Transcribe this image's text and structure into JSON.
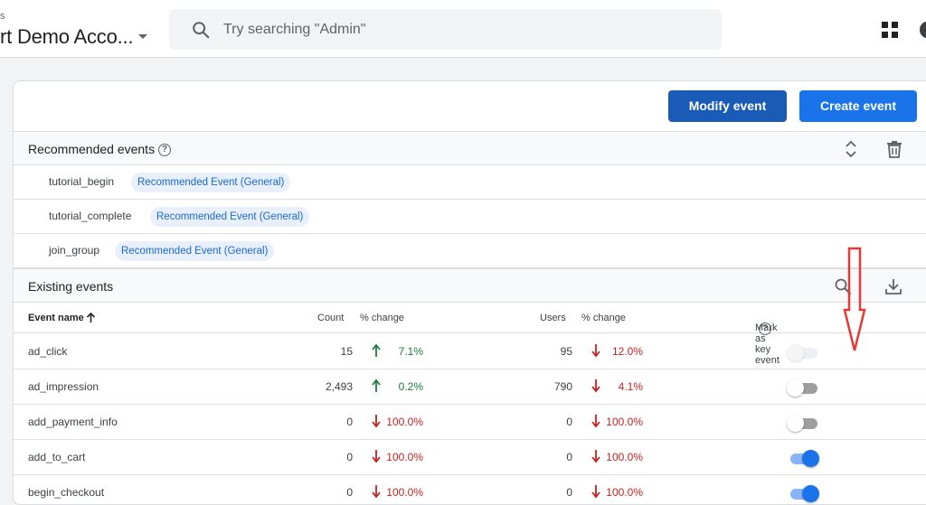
{
  "header": {
    "account_crumb": "s",
    "account_name": "rt Demo Acco...",
    "search_placeholder": "Try searching \"Admin\"",
    "apps_icon": "apps-grid-icon",
    "avatar_color": "#3c4043"
  },
  "actions": {
    "modify_label": "Modify event",
    "create_label": "Create event",
    "modify_color": "#1a5bb8",
    "create_color": "#1a73e8"
  },
  "recommended": {
    "title": "Recommended events",
    "help": "?",
    "items": [
      {
        "name": "tutorial_begin",
        "tag": "Recommended Event (General)"
      },
      {
        "name": "tutorial_complete",
        "tag": "Recommended Event (General)"
      },
      {
        "name": "join_group",
        "tag": "Recommended Event (General)"
      }
    ]
  },
  "existing": {
    "title": "Existing events",
    "columns": {
      "event_name": "Event name",
      "count": "Count",
      "count_change": "% change",
      "users": "Users",
      "users_change": "% change",
      "key_event": "Mark as key event"
    },
    "rows": [
      {
        "name": "ad_click",
        "count": "15",
        "count_change": "7.1%",
        "count_dir": "up",
        "users": "95",
        "users_change": "12.0%",
        "users_dir": "down",
        "key_event": "disabled"
      },
      {
        "name": "ad_impression",
        "count": "2,493",
        "count_change": "0.2%",
        "count_dir": "up",
        "users": "790",
        "users_change": "4.1%",
        "users_dir": "down",
        "key_event": "off"
      },
      {
        "name": "add_payment_info",
        "count": "0",
        "count_change": "100.0%",
        "count_dir": "down",
        "users": "0",
        "users_change": "100.0%",
        "users_dir": "down",
        "key_event": "off"
      },
      {
        "name": "add_to_cart",
        "count": "0",
        "count_change": "100.0%",
        "count_dir": "down",
        "users": "0",
        "users_change": "100.0%",
        "users_dir": "down",
        "key_event": "on"
      },
      {
        "name": "begin_checkout",
        "count": "0",
        "count_change": "100.0%",
        "count_dir": "down",
        "users": "0",
        "users_change": "100.0%",
        "users_dir": "down",
        "key_event": "on"
      }
    ]
  },
  "colors": {
    "up": "#188038",
    "down": "#c5221f",
    "annotation": "#e53935"
  }
}
